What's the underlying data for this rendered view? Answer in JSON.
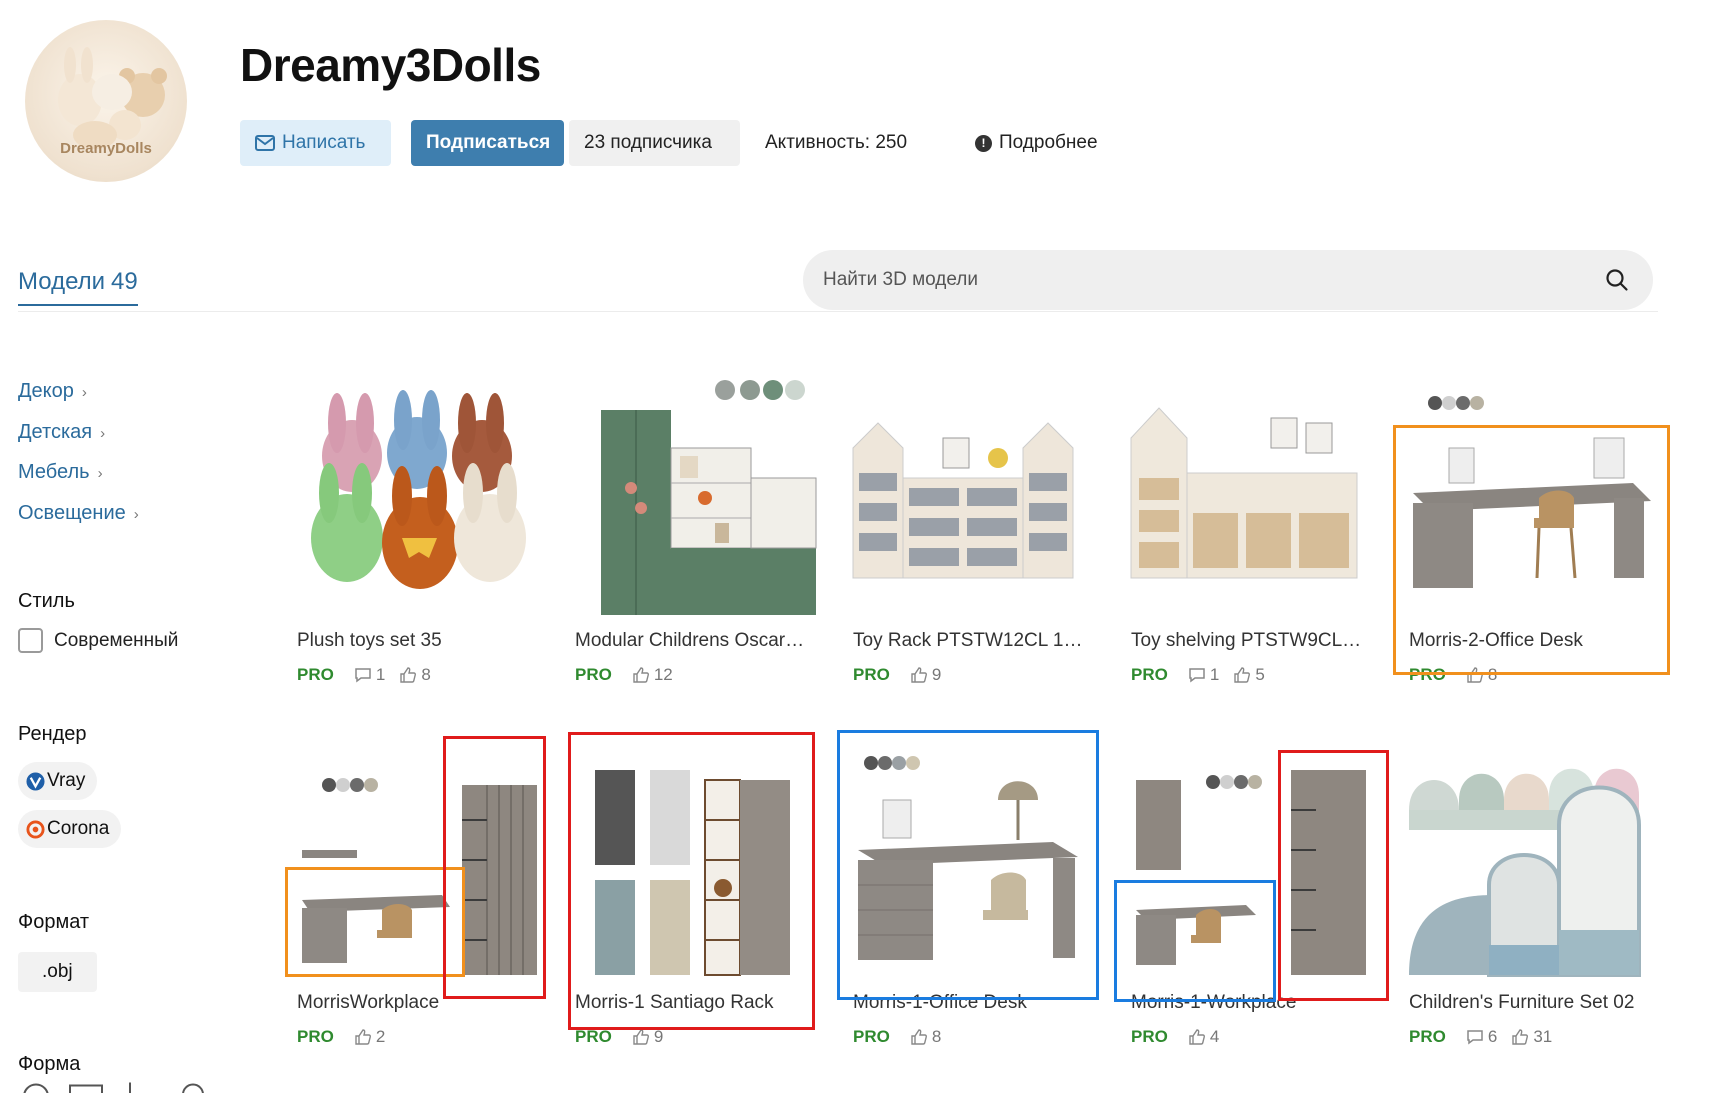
{
  "profile": {
    "avatar_label": "DreamyDolls",
    "name": "Dreamy3Dolls",
    "write_label": "Написать",
    "subscribe_label": "Подписаться",
    "followers_label": "23 подписчика",
    "activity_label": "Активность: 250",
    "more_label": "Подробнее"
  },
  "tabs": {
    "models_label": "Модели",
    "models_count": "49"
  },
  "search": {
    "placeholder": "Найти 3D модели"
  },
  "sidebar": {
    "categories": [
      "Декор",
      "Детская",
      "Мебель",
      "Освещение"
    ],
    "style_heading": "Стиль",
    "style_option": "Современный",
    "render_heading": "Рендер",
    "render_options": [
      "Vray",
      "Corona"
    ],
    "format_heading": "Формат",
    "format_option": ".obj",
    "shape_heading": "Форма"
  },
  "colors": {
    "accent": "#2b6b9c",
    "subscribe": "#3e7eae",
    "pro": "#2f8a2f",
    "box_orange": "#f1901d",
    "box_red": "#e01b1b",
    "box_blue": "#1a7ce0"
  },
  "models": [
    {
      "title": "Plush toys set 35",
      "pro": "PRO",
      "comments": "1",
      "likes": "8"
    },
    {
      "title": "Modular Childrens Oscar…",
      "pro": "PRO",
      "comments": null,
      "likes": "12"
    },
    {
      "title": "Toy Rack PTSTW12CL 1…",
      "pro": "PRO",
      "comments": null,
      "likes": "9"
    },
    {
      "title": "Toy shelving PTSTW9CL…",
      "pro": "PRO",
      "comments": "1",
      "likes": "5"
    },
    {
      "title": "Morris-2-Office Desk",
      "pro": "PRO",
      "comments": null,
      "likes": "8"
    },
    {
      "title": "MorrisWorkplace",
      "pro": "PRO",
      "comments": null,
      "likes": "2"
    },
    {
      "title": "Morris-1 Santiago Rack",
      "pro": "PRO",
      "comments": null,
      "likes": "9"
    },
    {
      "title": "Morris-1-Office Desk",
      "pro": "PRO",
      "comments": null,
      "likes": "8"
    },
    {
      "title": "Morris-1-Workplace",
      "pro": "PRO",
      "comments": null,
      "likes": "4"
    },
    {
      "title": "Children's Furniture Set 02",
      "pro": "PRO",
      "comments": "6",
      "likes": "31"
    }
  ]
}
